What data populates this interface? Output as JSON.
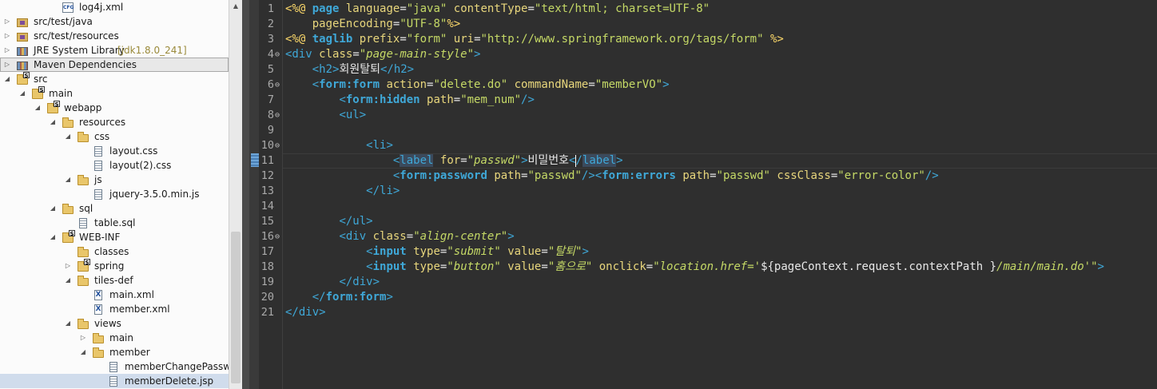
{
  "tree": {
    "items": [
      {
        "label": "log4j.xml",
        "depth": 3,
        "toggle": "",
        "icon": "cfg"
      },
      {
        "label": "src/test/java",
        "depth": 0,
        "toggle": "▷",
        "icon": "pkg"
      },
      {
        "label": "src/test/resources",
        "depth": 0,
        "toggle": "▷",
        "icon": "pkg"
      },
      {
        "label": "JRE System Library",
        "decoration": "[jdk1.8.0_241]",
        "depth": 0,
        "toggle": "▷",
        "icon": "lib"
      },
      {
        "label": "Maven Dependencies",
        "depth": 0,
        "toggle": "▷",
        "icon": "lib"
      },
      {
        "label": "src",
        "depth": 0,
        "toggle": "◢",
        "icon": "folder-badge"
      },
      {
        "label": "main",
        "depth": 1,
        "toggle": "◢",
        "icon": "folder-badge"
      },
      {
        "label": "webapp",
        "depth": 2,
        "toggle": "◢",
        "icon": "folder-badge"
      },
      {
        "label": "resources",
        "depth": 3,
        "toggle": "◢",
        "icon": "folder"
      },
      {
        "label": "css",
        "depth": 4,
        "toggle": "◢",
        "icon": "folder"
      },
      {
        "label": "layout.css",
        "depth": 5,
        "toggle": "",
        "icon": "file"
      },
      {
        "label": "layout(2).css",
        "depth": 5,
        "toggle": "",
        "icon": "file"
      },
      {
        "label": "js",
        "depth": 4,
        "toggle": "◢",
        "icon": "folder"
      },
      {
        "label": "jquery-3.5.0.min.js",
        "depth": 5,
        "toggle": "",
        "icon": "file"
      },
      {
        "label": "sql",
        "depth": 3,
        "toggle": "◢",
        "icon": "folder"
      },
      {
        "label": "table.sql",
        "depth": 4,
        "toggle": "",
        "icon": "file"
      },
      {
        "label": "WEB-INF",
        "depth": 3,
        "toggle": "◢",
        "icon": "folder-badge"
      },
      {
        "label": "classes",
        "depth": 4,
        "toggle": "",
        "icon": "folder"
      },
      {
        "label": "spring",
        "depth": 4,
        "toggle": "▷",
        "icon": "folder-badge"
      },
      {
        "label": "tiles-def",
        "depth": 4,
        "toggle": "◢",
        "icon": "folder"
      },
      {
        "label": "main.xml",
        "depth": 5,
        "toggle": "",
        "icon": "xml"
      },
      {
        "label": "member.xml",
        "depth": 5,
        "toggle": "",
        "icon": "xml"
      },
      {
        "label": "views",
        "depth": 4,
        "toggle": "◢",
        "icon": "folder"
      },
      {
        "label": "main",
        "depth": 5,
        "toggle": "▷",
        "icon": "folder"
      },
      {
        "label": "member",
        "depth": 5,
        "toggle": "◢",
        "icon": "folder"
      },
      {
        "label": "memberChangePasswor",
        "depth": 6,
        "toggle": "",
        "icon": "file"
      },
      {
        "label": "memberDelete.jsp",
        "depth": 6,
        "toggle": "",
        "icon": "file"
      }
    ],
    "highlighted_index": 4,
    "selected_index": 26
  },
  "editor": {
    "current_line": 11,
    "lines": [
      [
        [
          "t-dir",
          "<%@ "
        ],
        [
          "t-ftag",
          "page"
        ],
        [
          "t-txt",
          " "
        ],
        [
          "t-attr",
          "language"
        ],
        [
          "t-txt",
          "="
        ],
        [
          "t-val",
          "\"java\""
        ],
        [
          "t-txt",
          " "
        ],
        [
          "t-attr",
          "contentType"
        ],
        [
          "t-txt",
          "="
        ],
        [
          "t-val",
          "\"text/html; charset=UTF-8\""
        ]
      ],
      [
        [
          "t-txt",
          "    "
        ],
        [
          "t-attr",
          "pageEncoding"
        ],
        [
          "t-txt",
          "="
        ],
        [
          "t-val",
          "\"UTF-8\""
        ],
        [
          "t-dir",
          "%>"
        ]
      ],
      [
        [
          "t-dir",
          "<%@ "
        ],
        [
          "t-ftag",
          "taglib"
        ],
        [
          "t-txt",
          " "
        ],
        [
          "t-attr",
          "prefix"
        ],
        [
          "t-txt",
          "="
        ],
        [
          "t-val",
          "\"form\""
        ],
        [
          "t-txt",
          " "
        ],
        [
          "t-attr",
          "uri"
        ],
        [
          "t-txt",
          "="
        ],
        [
          "t-val",
          "\"http://www.springframework.org/tags/form\""
        ],
        [
          "t-txt",
          " "
        ],
        [
          "t-dir",
          "%>"
        ]
      ],
      [
        [
          "t-tag",
          "<div"
        ],
        [
          "t-txt",
          " "
        ],
        [
          "t-attr",
          "class"
        ],
        [
          "t-txt",
          "="
        ],
        [
          "t-ival",
          "\"page-main-style\""
        ],
        [
          "t-tag",
          ">"
        ]
      ],
      [
        [
          "t-txt",
          "    "
        ],
        [
          "t-tag",
          "<h2>"
        ],
        [
          "t-txt",
          "회원탈퇴"
        ],
        [
          "t-tag",
          "</h2>"
        ]
      ],
      [
        [
          "t-txt",
          "    "
        ],
        [
          "t-tag",
          "<"
        ],
        [
          "t-ftag",
          "form:form"
        ],
        [
          "t-txt",
          " "
        ],
        [
          "t-attr",
          "action"
        ],
        [
          "t-txt",
          "="
        ],
        [
          "t-val",
          "\"delete.do\""
        ],
        [
          "t-txt",
          " "
        ],
        [
          "t-attr",
          "commandName"
        ],
        [
          "t-txt",
          "="
        ],
        [
          "t-val",
          "\"memberVO\""
        ],
        [
          "t-tag",
          ">"
        ]
      ],
      [
        [
          "t-txt",
          "        "
        ],
        [
          "t-tag",
          "<"
        ],
        [
          "t-ftag",
          "form:hidden"
        ],
        [
          "t-txt",
          " "
        ],
        [
          "t-attr",
          "path"
        ],
        [
          "t-txt",
          "="
        ],
        [
          "t-val",
          "\"mem_num\""
        ],
        [
          "t-tag",
          "/>"
        ]
      ],
      [
        [
          "t-txt",
          "        "
        ],
        [
          "t-tag",
          "<ul>"
        ]
      ],
      [
        [
          "t-txt",
          ""
        ]
      ],
      [
        [
          "t-txt",
          "            "
        ],
        [
          "t-tag",
          "<li>"
        ]
      ],
      [
        [
          "t-txt",
          "                "
        ],
        [
          "t-tag",
          "<"
        ],
        [
          "t-hl",
          "label"
        ],
        [
          "t-txt",
          " "
        ],
        [
          "t-attr",
          "for"
        ],
        [
          "t-txt",
          "="
        ],
        [
          "t-ival",
          "\"passwd\""
        ],
        [
          "t-tag",
          ">"
        ],
        [
          "t-txt",
          "비밀번호"
        ],
        [
          "t-tag",
          "<"
        ],
        [
          "caret",
          ""
        ],
        [
          "t-tag",
          "/"
        ],
        [
          "t-hl",
          "label"
        ],
        [
          "t-tag",
          ">"
        ]
      ],
      [
        [
          "t-txt",
          "                "
        ],
        [
          "t-tag",
          "<"
        ],
        [
          "t-ftag",
          "form:password"
        ],
        [
          "t-txt",
          " "
        ],
        [
          "t-attr",
          "path"
        ],
        [
          "t-txt",
          "="
        ],
        [
          "t-val",
          "\"passwd\""
        ],
        [
          "t-tag",
          "/><"
        ],
        [
          "t-ftag",
          "form:errors"
        ],
        [
          "t-txt",
          " "
        ],
        [
          "t-attr",
          "path"
        ],
        [
          "t-txt",
          "="
        ],
        [
          "t-val",
          "\"passwd\""
        ],
        [
          "t-txt",
          " "
        ],
        [
          "t-attr",
          "cssClass"
        ],
        [
          "t-txt",
          "="
        ],
        [
          "t-val",
          "\"error-color\""
        ],
        [
          "t-tag",
          "/>"
        ]
      ],
      [
        [
          "t-txt",
          "            "
        ],
        [
          "t-tag",
          "</li>"
        ]
      ],
      [
        [
          "t-txt",
          ""
        ]
      ],
      [
        [
          "t-txt",
          "        "
        ],
        [
          "t-tag",
          "</ul>"
        ]
      ],
      [
        [
          "t-txt",
          "        "
        ],
        [
          "t-tag",
          "<div"
        ],
        [
          "t-txt",
          " "
        ],
        [
          "t-attr",
          "class"
        ],
        [
          "t-txt",
          "="
        ],
        [
          "t-ival",
          "\"align-center\""
        ],
        [
          "t-tag",
          ">"
        ]
      ],
      [
        [
          "t-txt",
          "            "
        ],
        [
          "t-tag",
          "<"
        ],
        [
          "t-ftag",
          "input"
        ],
        [
          "t-txt",
          " "
        ],
        [
          "t-attr",
          "type"
        ],
        [
          "t-txt",
          "="
        ],
        [
          "t-ival",
          "\"submit\""
        ],
        [
          "t-txt",
          " "
        ],
        [
          "t-attr",
          "value"
        ],
        [
          "t-txt",
          "="
        ],
        [
          "t-ival",
          "\"탈퇴\""
        ],
        [
          "t-tag",
          ">"
        ]
      ],
      [
        [
          "t-txt",
          "            "
        ],
        [
          "t-tag",
          "<"
        ],
        [
          "t-ftag",
          "input"
        ],
        [
          "t-txt",
          " "
        ],
        [
          "t-attr",
          "type"
        ],
        [
          "t-txt",
          "="
        ],
        [
          "t-ival",
          "\"button\""
        ],
        [
          "t-txt",
          " "
        ],
        [
          "t-attr",
          "value"
        ],
        [
          "t-txt",
          "="
        ],
        [
          "t-ival",
          "\"홈으로\""
        ],
        [
          "t-txt",
          " "
        ],
        [
          "t-attr",
          "onclick"
        ],
        [
          "t-txt",
          "="
        ],
        [
          "t-ival",
          "\"location.href='"
        ],
        [
          "t-txt",
          "${pageContext.request.contextPath }"
        ],
        [
          "t-ival",
          "/main/main.do'\""
        ],
        [
          "t-tag",
          ">"
        ]
      ],
      [
        [
          "t-txt",
          "        "
        ],
        [
          "t-tag",
          "</div>"
        ]
      ],
      [
        [
          "t-txt",
          "    "
        ],
        [
          "t-tag",
          "</"
        ],
        [
          "t-ftag",
          "form:form"
        ],
        [
          "t-tag",
          ">"
        ]
      ],
      [
        [
          "t-tag",
          "</div>"
        ]
      ]
    ],
    "fold_lines": [
      4,
      6,
      8,
      10,
      16
    ]
  }
}
